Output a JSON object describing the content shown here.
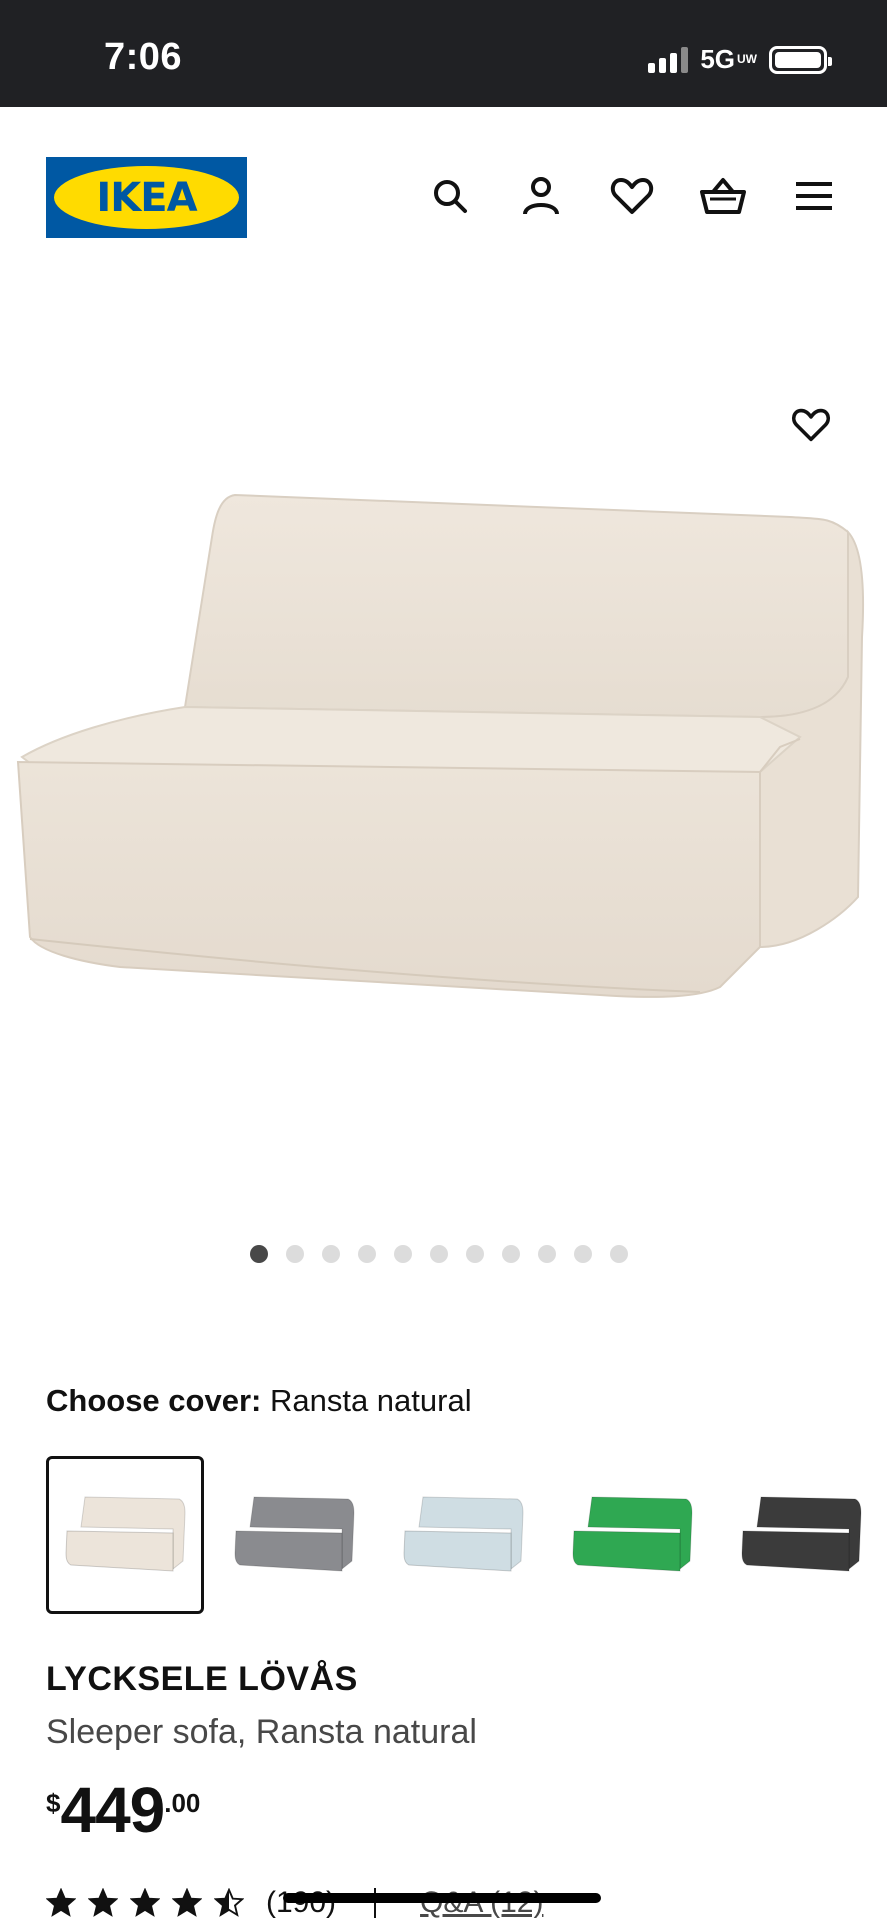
{
  "status_bar": {
    "time": "7:06",
    "network": "5G",
    "network_sub": "UW",
    "signal_bars_active": 3,
    "battery_level": 1.0
  },
  "header": {
    "logo_text": "IKEA",
    "icons": [
      "search-icon",
      "account-icon",
      "heart-icon",
      "basket-icon",
      "menu-icon"
    ]
  },
  "gallery": {
    "favorite_icon": "heart-icon",
    "image_count": 11,
    "active_index": 0
  },
  "cover": {
    "label": "Choose cover:",
    "value": "Ransta natural",
    "swatch_colors": [
      "#ece4da",
      "#8a8b8f",
      "#cfdde3",
      "#2fa852",
      "#3b3b3b"
    ],
    "selected_index": 0
  },
  "product": {
    "name": "LYCKSELE LÖVÅS",
    "description": "Sleeper sofa, Ransta natural",
    "price_currency": "$",
    "price_integer": "449",
    "price_decimal": ".00"
  },
  "rating": {
    "value": 4.5,
    "max": 5,
    "count_text": "(190)",
    "qa_text": "Q&A (12)"
  },
  "colors": {
    "brand_blue": "#0058a3",
    "brand_yellow": "#ffdb00",
    "status_bar_bg": "#202124"
  }
}
